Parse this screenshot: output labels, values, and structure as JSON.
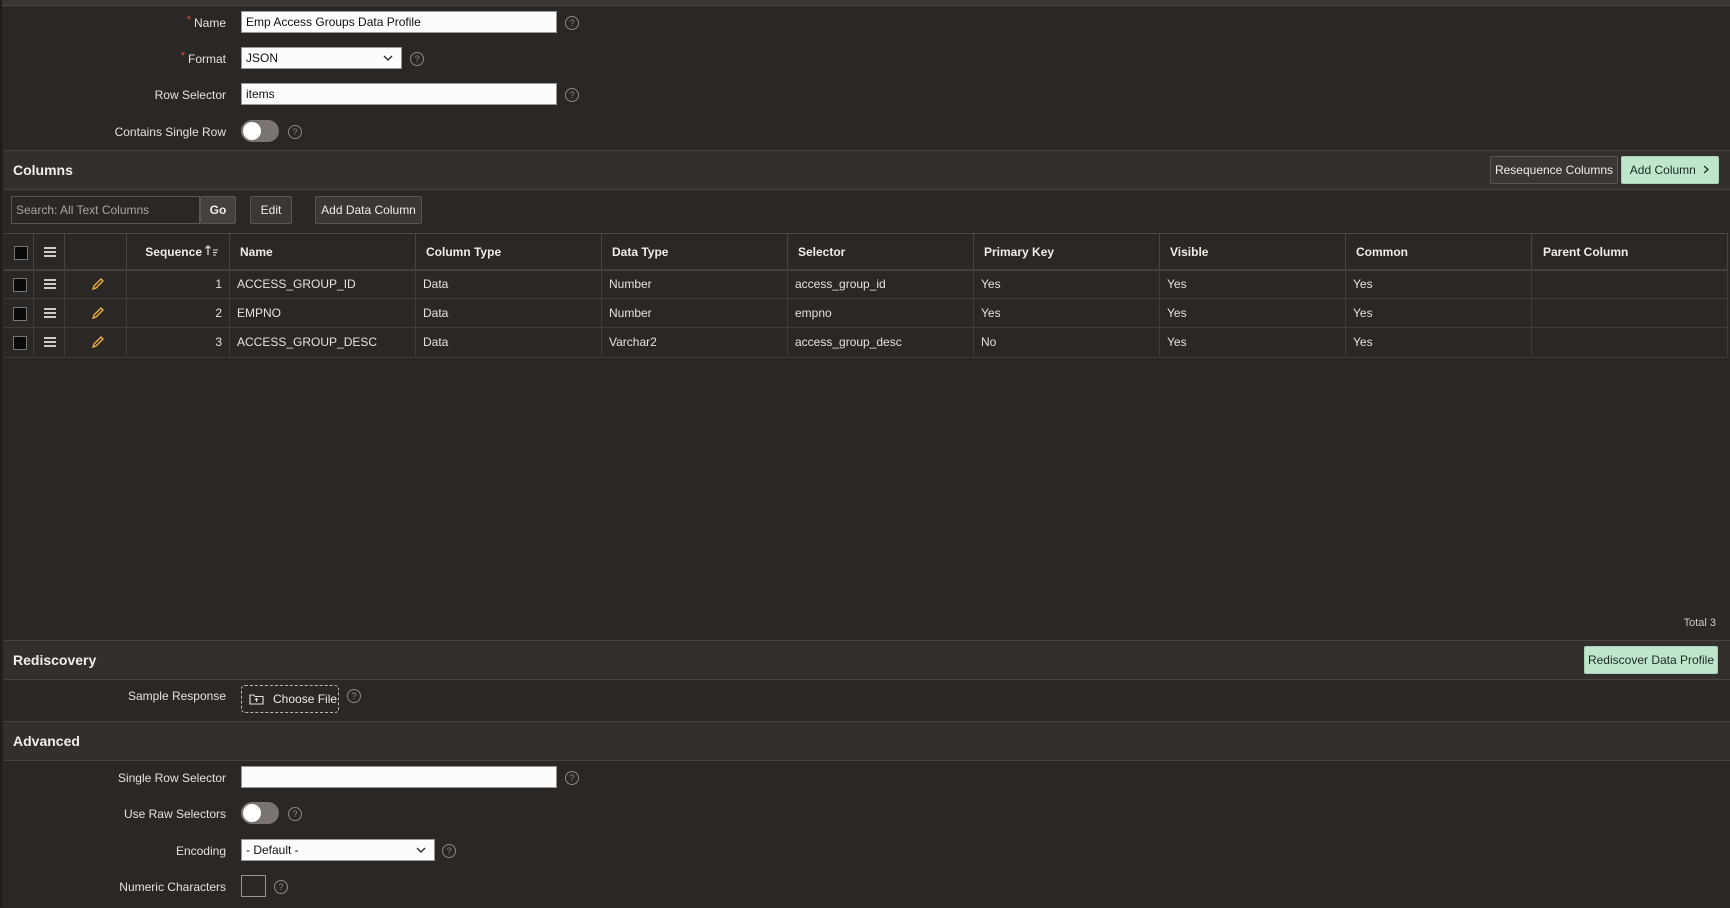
{
  "form": {
    "name_label": "Name",
    "name_value": "Emp Access Groups Data Profile",
    "format_label": "Format",
    "format_value": "JSON",
    "row_selector_label": "Row Selector",
    "row_selector_value": "items",
    "single_row_label": "Contains Single Row",
    "required_mark": "*"
  },
  "columns_section": {
    "title": "Columns",
    "resequence_label": "Resequence Columns",
    "add_column_label": "Add Column",
    "search_placeholder": "Search: All Text Columns",
    "go_label": "Go",
    "edit_label": "Edit",
    "add_data_column_label": "Add Data Column",
    "headers": [
      "Sequence",
      "Name",
      "Column Type",
      "Data Type",
      "Selector",
      "Primary Key",
      "Visible",
      "Common",
      "Parent Column"
    ],
    "rows": [
      {
        "seq": "1",
        "name": "ACCESS_GROUP_ID",
        "ctype": "Data",
        "dtype": "Number",
        "selector": "access_group_id",
        "pk": "Yes",
        "visible": "Yes",
        "common": "Yes",
        "parent": ""
      },
      {
        "seq": "2",
        "name": "EMPNO",
        "ctype": "Data",
        "dtype": "Number",
        "selector": "empno",
        "pk": "Yes",
        "visible": "Yes",
        "common": "Yes",
        "parent": ""
      },
      {
        "seq": "3",
        "name": "ACCESS_GROUP_DESC",
        "ctype": "Data",
        "dtype": "Varchar2",
        "selector": "access_group_desc",
        "pk": "No",
        "visible": "Yes",
        "common": "Yes",
        "parent": ""
      }
    ],
    "total": "Total 3"
  },
  "rediscovery": {
    "title": "Rediscovery",
    "button_label": "Rediscover Data Profile",
    "sample_label": "Sample Response",
    "choose_file_label": "Choose File"
  },
  "advanced": {
    "title": "Advanced",
    "single_row_selector_label": "Single Row Selector",
    "single_row_selector_value": "",
    "raw_selectors_label": "Use Raw Selectors",
    "encoding_label": "Encoding",
    "encoding_value": "- Default -",
    "numeric_label": "Numeric Characters",
    "numeric_value": ""
  },
  "colors": {
    "accent_green": "#bfe6cc",
    "edit_pencil": "#e8b040",
    "required": "#e24b3b"
  },
  "icons": [
    "help-icon",
    "chevron-down-icon",
    "chevron-right-icon",
    "sort-ascending-icon",
    "row-menu-icon",
    "edit-pencil-icon",
    "folder-upload-icon"
  ]
}
